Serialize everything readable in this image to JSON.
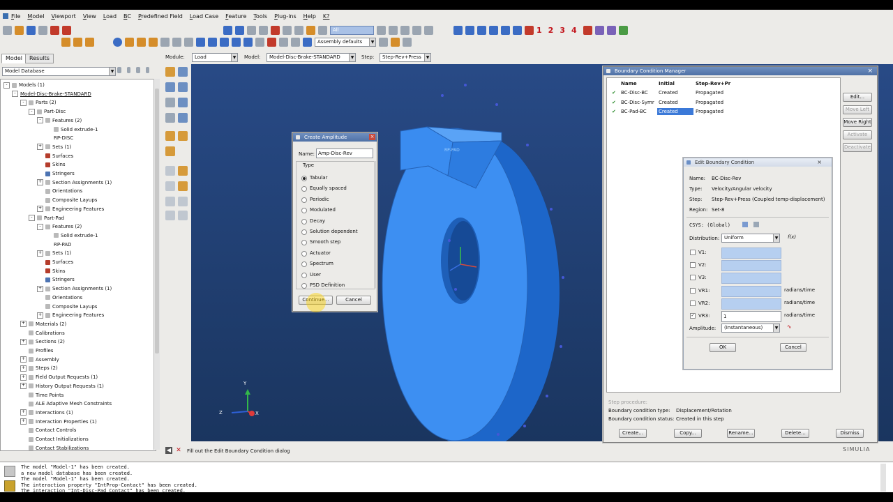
{
  "menubar": {
    "items": [
      "File",
      "Model",
      "Viewport",
      "View",
      "Load",
      "BC",
      "Predefined Field",
      "Load Case",
      "Feature",
      "Tools",
      "Plug-ins",
      "Help",
      "K?"
    ]
  },
  "toolbar": {
    "filter_value": "All",
    "render_style": "Assembly defaults",
    "view_numbers": [
      "1",
      "2",
      "3",
      "4"
    ]
  },
  "context": {
    "module_label": "Module:",
    "module_value": "Load",
    "model_label": "Model:",
    "model_value": "Model-Disc-Brake-STANDARD",
    "step_label": "Step:",
    "step_value": "Step-Rev+Press"
  },
  "tabs": {
    "model": "Model",
    "results": "Results"
  },
  "tree": {
    "db_combo": "Model Database",
    "rows": [
      {
        "text": "Models (1)",
        "indent": 0,
        "exp": "-",
        "icon": "doc"
      },
      {
        "text": "Model-Disc-Brake-STANDARD",
        "indent": 1,
        "exp": "-",
        "icon": "none"
      },
      {
        "text": "Parts (2)",
        "indent": 2,
        "exp": "-",
        "icon": "doc"
      },
      {
        "text": "Part-Disc",
        "indent": 3,
        "exp": "-",
        "icon": "doc"
      },
      {
        "text": "Features (2)",
        "indent": 4,
        "exp": "-",
        "icon": "doc"
      },
      {
        "text": "Solid extrude-1",
        "indent": 5,
        "exp": "",
        "icon": "doc"
      },
      {
        "text": "RP-DISC",
        "indent": 5,
        "exp": "",
        "icon": "none"
      },
      {
        "text": "Sets (1)",
        "indent": 4,
        "exp": "+",
        "icon": "doc"
      },
      {
        "text": "Surfaces",
        "indent": 4,
        "exp": "",
        "icon": "red"
      },
      {
        "text": "Skins",
        "indent": 4,
        "exp": "",
        "icon": "red"
      },
      {
        "text": "Stringers",
        "indent": 4,
        "exp": "",
        "icon": "blue"
      },
      {
        "text": "Section Assignments (1)",
        "indent": 4,
        "exp": "+",
        "icon": "doc"
      },
      {
        "text": "Orientations",
        "indent": 4,
        "exp": "",
        "icon": "doc"
      },
      {
        "text": "Composite Layups",
        "indent": 4,
        "exp": "",
        "icon": "doc"
      },
      {
        "text": "Engineering Features",
        "indent": 4,
        "exp": "+",
        "icon": "doc"
      },
      {
        "text": "Part-Pad",
        "indent": 3,
        "exp": "-",
        "icon": "doc"
      },
      {
        "text": "Features (2)",
        "indent": 4,
        "exp": "-",
        "icon": "doc"
      },
      {
        "text": "Solid extrude-1",
        "indent": 5,
        "exp": "",
        "icon": "doc"
      },
      {
        "text": "RP-PAD",
        "indent": 5,
        "exp": "",
        "icon": "none"
      },
      {
        "text": "Sets (1)",
        "indent": 4,
        "exp": "+",
        "icon": "doc"
      },
      {
        "text": "Surfaces",
        "indent": 4,
        "exp": "",
        "icon": "red"
      },
      {
        "text": "Skins",
        "indent": 4,
        "exp": "",
        "icon": "red"
      },
      {
        "text": "Stringers",
        "indent": 4,
        "exp": "",
        "icon": "blue"
      },
      {
        "text": "Section Assignments (1)",
        "indent": 4,
        "exp": "+",
        "icon": "doc"
      },
      {
        "text": "Orientations",
        "indent": 4,
        "exp": "",
        "icon": "doc"
      },
      {
        "text": "Composite Layups",
        "indent": 4,
        "exp": "",
        "icon": "doc"
      },
      {
        "text": "Engineering Features",
        "indent": 4,
        "exp": "+",
        "icon": "doc"
      },
      {
        "text": "Materials (2)",
        "indent": 2,
        "exp": "+",
        "icon": "doc"
      },
      {
        "text": "Calibrations",
        "indent": 2,
        "exp": "",
        "icon": "doc"
      },
      {
        "text": "Sections (2)",
        "indent": 2,
        "exp": "+",
        "icon": "doc"
      },
      {
        "text": "Profiles",
        "indent": 2,
        "exp": "",
        "icon": "doc"
      },
      {
        "text": "Assembly",
        "indent": 2,
        "exp": "+",
        "icon": "doc"
      },
      {
        "text": "Steps (2)",
        "indent": 2,
        "exp": "+",
        "icon": "doc"
      },
      {
        "text": "Field Output Requests (1)",
        "indent": 2,
        "exp": "+",
        "icon": "doc"
      },
      {
        "text": "History Output Requests (1)",
        "indent": 2,
        "exp": "+",
        "icon": "doc"
      },
      {
        "text": "Time Points",
        "indent": 2,
        "exp": "",
        "icon": "doc"
      },
      {
        "text": "ALE Adaptive Mesh Constraints",
        "indent": 2,
        "exp": "",
        "icon": "doc"
      },
      {
        "text": "Interactions (1)",
        "indent": 2,
        "exp": "+",
        "icon": "doc"
      },
      {
        "text": "Interaction Properties (1)",
        "indent": 2,
        "exp": "+",
        "icon": "doc"
      },
      {
        "text": "Contact Controls",
        "indent": 2,
        "exp": "",
        "icon": "doc"
      },
      {
        "text": "Contact Initializations",
        "indent": 2,
        "exp": "",
        "icon": "doc"
      },
      {
        "text": "Contact Stabilizations",
        "indent": 2,
        "exp": "",
        "icon": "doc"
      }
    ]
  },
  "viewport": {
    "part_label": "RP-PAD",
    "triad": {
      "x": "X",
      "y": "Y",
      "z": "Z"
    },
    "brand": "SIMULIA"
  },
  "create_amplitude": {
    "title": "Create Amplitude",
    "name_label": "Name:",
    "name_value": "Amp-Disc-Rev",
    "type_label": "Type",
    "types": [
      "Tabular",
      "Equally spaced",
      "Periodic",
      "Modulated",
      "Decay",
      "Solution dependent",
      "Smooth step",
      "Actuator",
      "Spectrum",
      "User",
      "PSD Definition"
    ],
    "selected_type": "Tabular",
    "continue_label": "Continue...",
    "cancel_label": "Cancel"
  },
  "bc_manager": {
    "title": "Boundary Condition Manager",
    "headers": [
      "Name",
      "Initial",
      "Step-Rev+Pr"
    ],
    "rows": [
      {
        "check": "✔",
        "name": "BC-Disc-BC",
        "initial": "Created",
        "step": "Propagated"
      },
      {
        "check": "✔",
        "name": "BC-Disc-Symr",
        "initial": "Created",
        "step": "Propagated"
      },
      {
        "check": "✔",
        "name": "BC-Pad-BC",
        "initial": "Created",
        "step": "Propagated"
      }
    ],
    "side_buttons": [
      "Edit...",
      "Move Left",
      "Move Right",
      "Activate",
      "Deactivate"
    ],
    "step_procedure_label": "Step procedure:",
    "bc_type_label": "Boundary condition type:",
    "bc_type_value": "Displacement/Rotation",
    "bc_status_label": "Boundary condition status:",
    "bc_status_value": "Created in this step",
    "bottom_buttons": [
      "Create...",
      "Copy...",
      "Rename...",
      "Delete...",
      "Dismiss"
    ]
  },
  "edit_bc": {
    "title": "Edit Boundary Condition",
    "name_label": "Name:",
    "name_value": "BC-Disc-Rev",
    "type_label": "Type:",
    "type_value": "Velocity/Angular velocity",
    "step_label": "Step:",
    "step_value": "Step-Rev+Press (Coupled temp-displacement)",
    "region_label": "Region:",
    "region_value": "Set-8",
    "csys_label": "CSYS: (Global)",
    "distribution_label": "Distribution:",
    "distribution_value": "Uniform",
    "fx_label": "f(x)",
    "components": [
      {
        "label": "V1:",
        "value": "",
        "unit": "",
        "checked": false
      },
      {
        "label": "V2:",
        "value": "",
        "unit": "",
        "checked": false
      },
      {
        "label": "V3:",
        "value": "",
        "unit": "",
        "checked": false
      },
      {
        "label": "VR1:",
        "value": "",
        "unit": "radians/time",
        "checked": false
      },
      {
        "label": "VR2:",
        "value": "",
        "unit": "radians/time",
        "checked": false
      },
      {
        "label": "VR3:",
        "value": "1",
        "unit": "radians/time",
        "checked": true
      }
    ],
    "amplitude_label": "Amplitude:",
    "amplitude_value": "(Instantaneous)",
    "ok_label": "OK",
    "cancel_label": "Cancel"
  },
  "prompt": {
    "text": "Fill out the Edit Boundary Condition dialog"
  },
  "messages": [
    "The model \"Model-1\" has been created.",
    "a new model database has been created.",
    "The model \"Model-1\" has been created.",
    "The interaction property \"IntProp-Contact\" has been created.",
    "The interaction \"Int-Disc-Pad Contact\" has been created."
  ]
}
